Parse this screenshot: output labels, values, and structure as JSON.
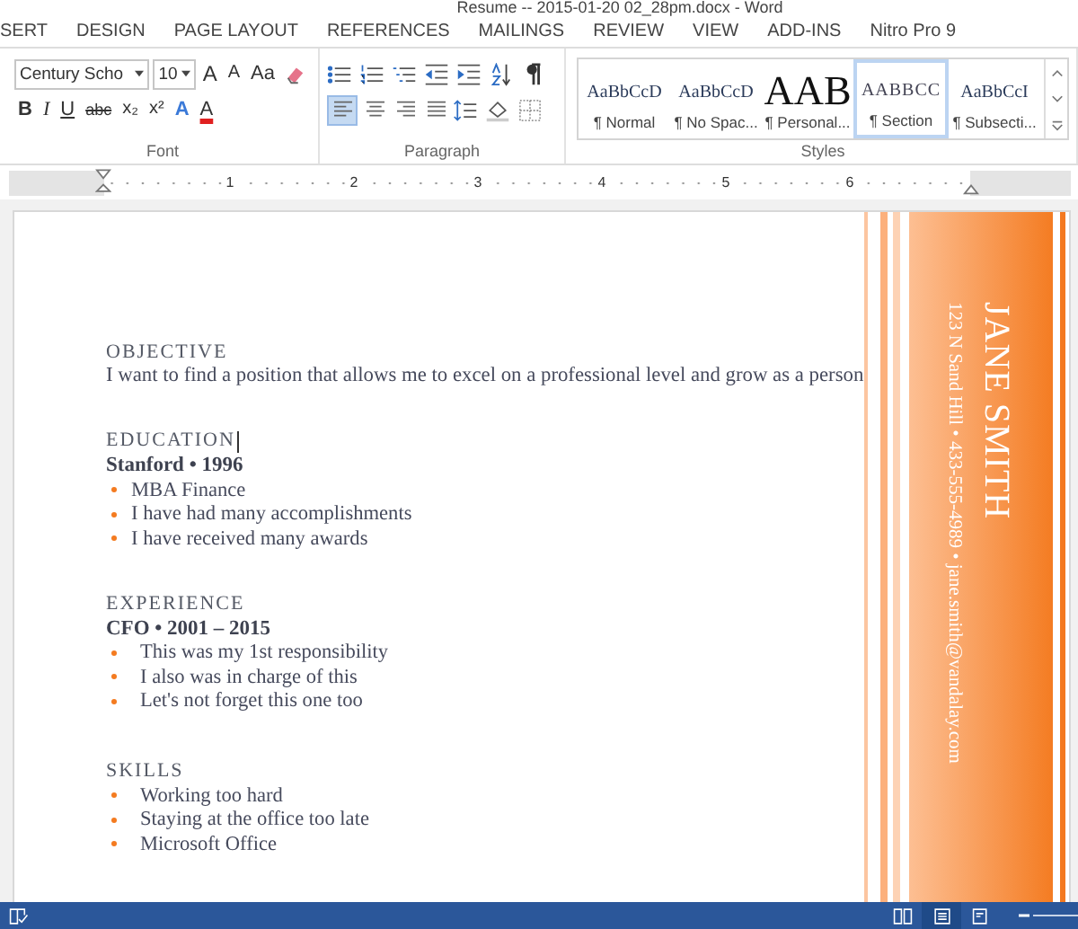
{
  "window": {
    "title": "Resume -- 2015-01-20 02_28pm.docx - Word"
  },
  "menu_tabs": [
    "SERT",
    "DESIGN",
    "PAGE LAYOUT",
    "REFERENCES",
    "MAILINGS",
    "REVIEW",
    "VIEW",
    "ADD-INS",
    "Nitro Pro 9"
  ],
  "ribbon": {
    "font": {
      "group_label": "Font",
      "font_name": "Century Scho",
      "font_size": "10",
      "row1": [
        {
          "label": "A",
          "kind": "grow"
        },
        {
          "label": "A",
          "kind": "shrink"
        },
        {
          "label": "Aa",
          "kind": "case"
        }
      ],
      "row2": [
        {
          "label": "B",
          "kind": "bold"
        },
        {
          "label": "I",
          "kind": "italic"
        },
        {
          "label": "U",
          "kind": "underline"
        },
        {
          "label": "abc",
          "kind": "strike"
        },
        {
          "label": "x₂",
          "kind": "sub"
        },
        {
          "label": "x²",
          "kind": "sup"
        },
        {
          "label": "A",
          "kind": "effects"
        },
        {
          "label": "A",
          "kind": "color"
        }
      ]
    },
    "paragraph": {
      "group_label": "Paragraph",
      "alignment": [
        {
          "selected": true
        },
        {
          "selected": false
        },
        {
          "selected": false
        },
        {
          "selected": false
        }
      ]
    },
    "styles": {
      "group_label": "Styles",
      "items": [
        {
          "preview": "AaBbCcD",
          "name": "¶ Normal",
          "kind": "body",
          "selected": false
        },
        {
          "preview": "AaBbCcD",
          "name": "¶ No Spac...",
          "kind": "body",
          "selected": false
        },
        {
          "preview": "AAB",
          "name": "¶ Personal...",
          "kind": "title",
          "selected": false
        },
        {
          "preview": "AABBCC",
          "name": "¶ Section",
          "kind": "caps",
          "selected": true
        },
        {
          "preview": "AaBbCcI",
          "name": "¶ Subsecti...",
          "kind": "body",
          "selected": false
        }
      ]
    }
  },
  "ruler": {
    "numbers": [
      "1",
      "2",
      "3",
      "4",
      "5",
      "6"
    ]
  },
  "document": {
    "sidebar": {
      "name": "JANE SMITH",
      "contact": "123 N Sand Hill • 433-555-4989 • jane.smith@vandalay.com"
    },
    "sections": [
      {
        "heading": "OBJECTIVE",
        "text": "I want to find a position that allows me to excel on a professional level and grow as a person"
      },
      {
        "heading": "EDUCATION",
        "subheading": "Stanford • 1996",
        "bullets": [
          "MBA Finance",
          "I have had many accomplishments",
          "I have received many awards"
        ]
      },
      {
        "heading": "EXPERIENCE",
        "subheading": "CFO • 2001 – 2015",
        "bullets": [
          "This was my 1st responsibility",
          "I also was in charge of this",
          "Let's not forget this one too"
        ]
      },
      {
        "heading": "SKILLS",
        "bullets": [
          "Working too hard",
          "Staying at the office too late",
          "Microsoft Office"
        ]
      }
    ]
  },
  "status_bar": {
    "views": [
      {
        "selected": false
      },
      {
        "selected": true
      },
      {
        "selected": false
      }
    ],
    "zoom_slider": {
      "level": 1
    }
  }
}
